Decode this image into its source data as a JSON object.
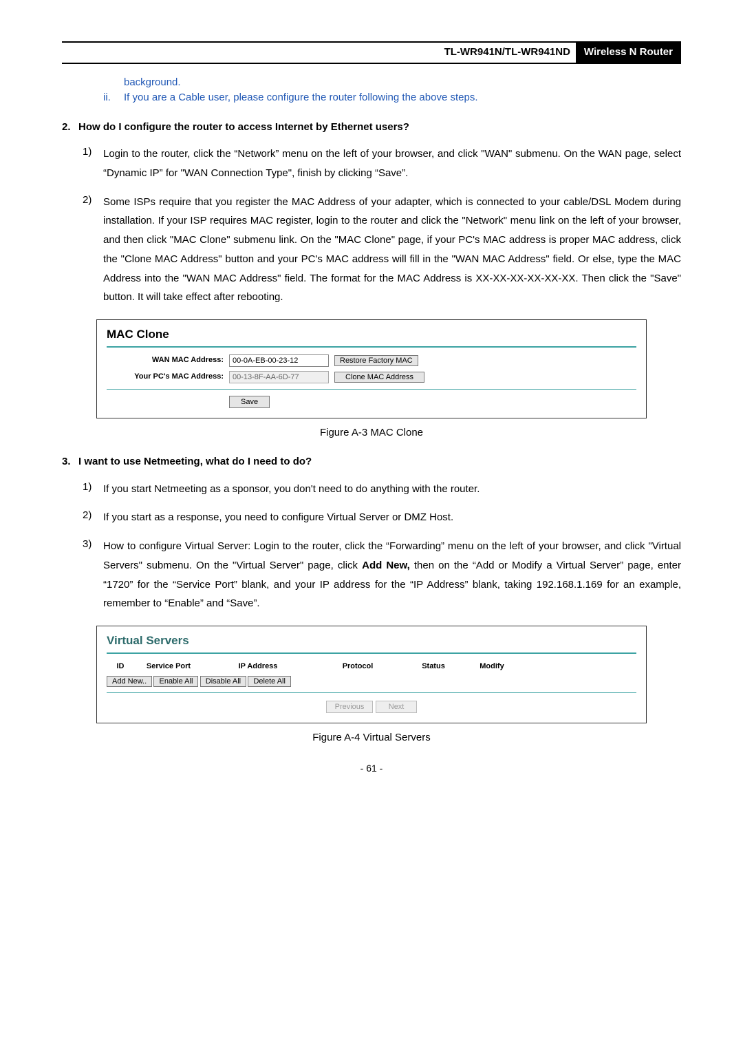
{
  "header": {
    "model": "TL-WR941N/TL-WR941ND",
    "label": "Wireless  N  Router"
  },
  "pre": {
    "background": "background.",
    "roman_ii_num": "ii.",
    "roman_ii_text": "If you are a Cable user, please configure the router following the above steps."
  },
  "q2": {
    "num": "2.",
    "title": "How do I configure the router to access Internet by Ethernet users?",
    "step1_num": "1)",
    "step1_text": "Login to the router, click the “Network” menu on the left of your browser, and click \"WAN\" submenu. On the WAN page, select “Dynamic IP” for \"WAN Connection Type\", finish by clicking “Save”.",
    "step2_num": "2)",
    "step2_text": "Some ISPs require that you register the MAC Address of your adapter, which is connected to your cable/DSL Modem during installation. If your ISP requires MAC register, login to the router and click the \"Network\" menu link on the left of your browser, and then click \"MAC Clone\" submenu link. On the \"MAC Clone\" page, if your PC's MAC address is proper MAC address, click the \"Clone MAC Address\" button and your PC's MAC address will fill in the \"WAN MAC Address\" field. Or else, type the MAC Address into the \"WAN MAC Address\" field. The format for the MAC Address is XX-XX-XX-XX-XX-XX. Then click the \"Save\" button. It will take effect after rebooting."
  },
  "figA3": {
    "title": "MAC Clone",
    "wan_label": "WAN MAC Address:",
    "wan_value": "00-0A-EB-00-23-12",
    "restore_btn": "Restore Factory MAC",
    "pc_label": "Your PC's MAC Address:",
    "pc_value": "00-13-8F-AA-6D-77",
    "clone_btn": "Clone MAC Address",
    "save_btn": "Save",
    "caption": "Figure A-3    MAC Clone"
  },
  "q3": {
    "num": "3.",
    "title": "I want to use Netmeeting, what do I need to do?",
    "step1_num": "1)",
    "step1_text": "If you start Netmeeting as a sponsor, you don't need to do anything with the router.",
    "step2_num": "2)",
    "step2_text": "If you start as a response, you need to configure Virtual Server or DMZ Host.",
    "step3_num": "3)",
    "step3_text_a": "How to configure Virtual Server: Login to the router, click the “Forwarding” menu on the left of your browser, and click \"Virtual Servers\" submenu. On the \"Virtual Server\" page, click ",
    "step3_text_b": "Add New,",
    "step3_text_c": " then on the “Add or Modify a Virtual Server” page,   enter “1720” for the “Service Port” blank, and your IP address for the “IP Address” blank, taking 192.168.1.169 for an example, remember to “Enable” and “Save”."
  },
  "figA4": {
    "title": "Virtual Servers",
    "col_id": "ID",
    "col_sp": "Service Port",
    "col_ip": "IP Address",
    "col_proto": "Protocol",
    "col_status": "Status",
    "col_modify": "Modify",
    "add_new": "Add New..",
    "enable_all": "Enable All",
    "disable_all": "Disable All",
    "delete_all": "Delete All",
    "prev": "Previous",
    "next": "Next",
    "caption": "Figure A-4    Virtual Servers"
  },
  "page_number": "- 61 -"
}
